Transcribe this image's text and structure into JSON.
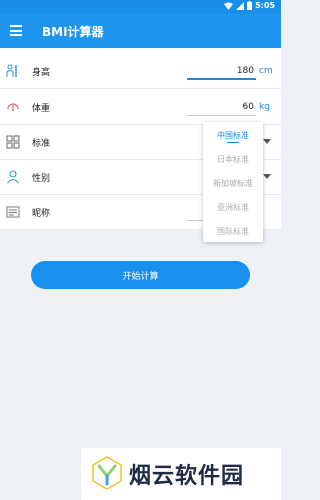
{
  "status_bar": {
    "time": "5:05"
  },
  "app_bar": {
    "title": "BMI计算器"
  },
  "form": {
    "height": {
      "label": "身高",
      "value": "180",
      "unit": "cm"
    },
    "weight": {
      "label": "体重",
      "value": "60",
      "unit": "kg"
    },
    "standard": {
      "label": "标准"
    },
    "gender": {
      "label": "性别"
    },
    "nickname": {
      "label": "昵称"
    }
  },
  "dropdown": {
    "options": [
      "中国标准",
      "日本标准",
      "新加坡标准",
      "亚洲标准",
      "国际标准"
    ],
    "selected_index": 0
  },
  "start_button": {
    "label": "开始计算"
  },
  "watermark": {
    "text": "烟云软件园"
  },
  "colors": {
    "primary": "#1e96f0",
    "accent": "#1e88e5"
  }
}
